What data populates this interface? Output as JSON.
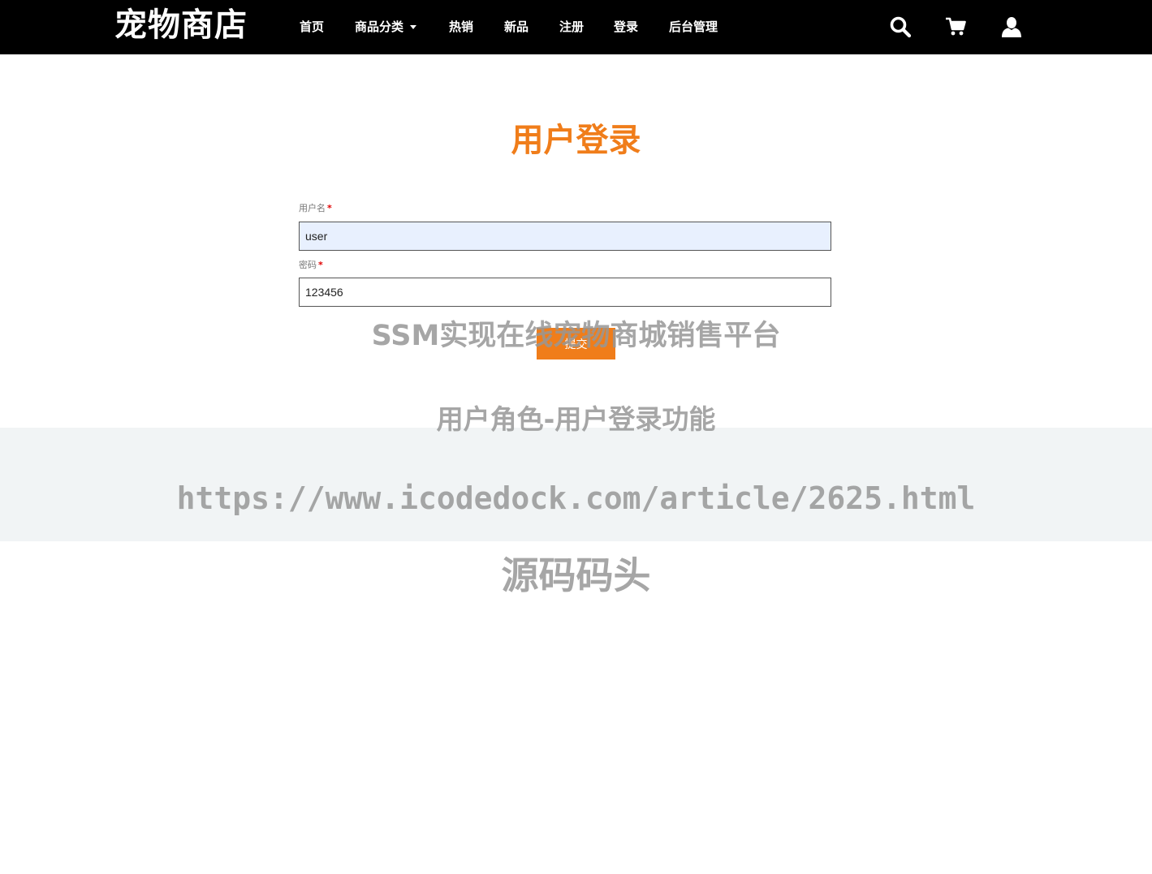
{
  "colors": {
    "accent": "#f07d1a",
    "header_bg": "#000000",
    "required": "#e00000"
  },
  "header": {
    "brand": "宠物商店",
    "nav": [
      {
        "label": "首页"
      },
      {
        "label": "商品分类",
        "dropdown": true
      },
      {
        "label": "热销"
      },
      {
        "label": "新品"
      },
      {
        "label": "注册"
      },
      {
        "label": "登录"
      },
      {
        "label": "后台管理"
      }
    ],
    "icons": [
      "search-icon",
      "cart-icon",
      "user-icon"
    ]
  },
  "login": {
    "title": "用户登录",
    "username": {
      "label": "用户名",
      "required_mark": "*",
      "value": "user"
    },
    "password": {
      "label": "密码",
      "required_mark": "*",
      "value": "123456"
    },
    "submit_label": "提交"
  },
  "watermark": {
    "line1": "SSM实现在线宠物商城销售平台",
    "line2": "用户角色-用户登录功能",
    "line3": "https://www.icodedock.com/article/2625.html",
    "line4": "源码码头"
  }
}
